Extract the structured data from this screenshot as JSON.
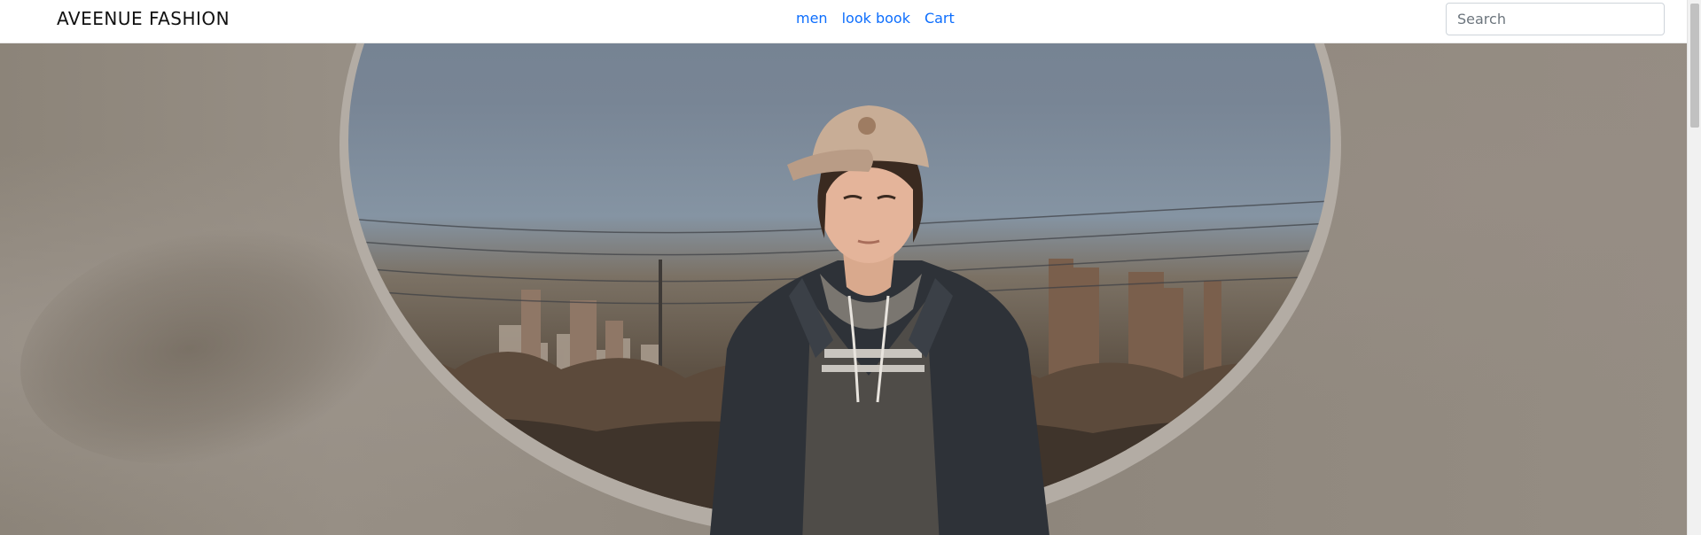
{
  "navbar": {
    "brand": "AVEENUE FASHION",
    "links": [
      {
        "label": "men"
      },
      {
        "label": "look book"
      },
      {
        "label": "Cart"
      }
    ],
    "search": {
      "placeholder": "Search",
      "value": ""
    }
  },
  "colors": {
    "link": "#0d6efd",
    "brand_text": "#111111",
    "hero_wall": "#8f877f"
  },
  "icons": {
    "hero": "photo-of-young-man-in-cap"
  }
}
